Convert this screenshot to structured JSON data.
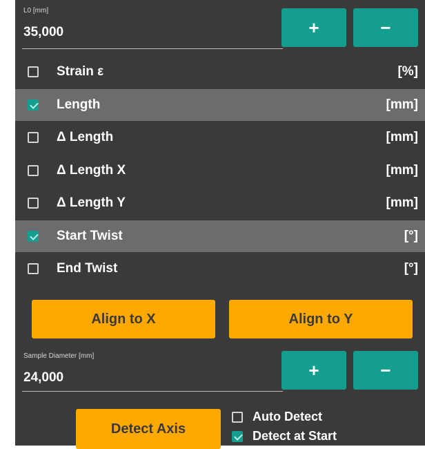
{
  "lo_field": {
    "caption": "L0 [mm]",
    "value": "35,000"
  },
  "buttons": {
    "plus": "+",
    "minus": "−"
  },
  "measurements": [
    {
      "label": "Strain ε",
      "unit": "[%]",
      "checked": false,
      "selected": false
    },
    {
      "label": "Length",
      "unit": "[mm]",
      "checked": true,
      "selected": true
    },
    {
      "label": "Δ Length",
      "unit": "[mm]",
      "checked": false,
      "selected": false
    },
    {
      "label": "Δ Length X",
      "unit": "[mm]",
      "checked": false,
      "selected": false
    },
    {
      "label": "Δ Length Y",
      "unit": "[mm]",
      "checked": false,
      "selected": false
    },
    {
      "label": "Start Twist",
      "unit": "[°]",
      "checked": true,
      "selected": true
    },
    {
      "label": "End Twist",
      "unit": "[°]",
      "checked": false,
      "selected": false
    }
  ],
  "align": {
    "x_label": "Align to X",
    "y_label": "Align to Y"
  },
  "diameter_field": {
    "caption": "Sample Diameter [mm]",
    "value": "24,000"
  },
  "detect": {
    "button_label": "Detect Axis",
    "auto_detect": {
      "label": "Auto Detect",
      "checked": false
    },
    "detect_at_start": {
      "label": "Detect at Start",
      "checked": true
    }
  },
  "colors": {
    "panel": "#3a3a3a",
    "accent": "#139e8f",
    "orange": "#ffa800",
    "selected_row": "#6c6c6c"
  }
}
